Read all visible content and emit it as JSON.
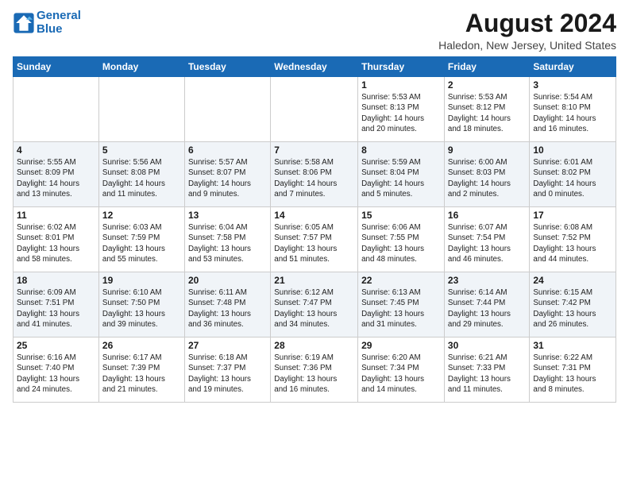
{
  "header": {
    "logo_line1": "General",
    "logo_line2": "Blue",
    "main_title": "August 2024",
    "subtitle": "Haledon, New Jersey, United States"
  },
  "calendar": {
    "days_of_week": [
      "Sunday",
      "Monday",
      "Tuesday",
      "Wednesday",
      "Thursday",
      "Friday",
      "Saturday"
    ],
    "weeks": [
      [
        {
          "day": "",
          "info": ""
        },
        {
          "day": "",
          "info": ""
        },
        {
          "day": "",
          "info": ""
        },
        {
          "day": "",
          "info": ""
        },
        {
          "day": "1",
          "info": "Sunrise: 5:53 AM\nSunset: 8:13 PM\nDaylight: 14 hours\nand 20 minutes."
        },
        {
          "day": "2",
          "info": "Sunrise: 5:53 AM\nSunset: 8:12 PM\nDaylight: 14 hours\nand 18 minutes."
        },
        {
          "day": "3",
          "info": "Sunrise: 5:54 AM\nSunset: 8:10 PM\nDaylight: 14 hours\nand 16 minutes."
        }
      ],
      [
        {
          "day": "4",
          "info": "Sunrise: 5:55 AM\nSunset: 8:09 PM\nDaylight: 14 hours\nand 13 minutes."
        },
        {
          "day": "5",
          "info": "Sunrise: 5:56 AM\nSunset: 8:08 PM\nDaylight: 14 hours\nand 11 minutes."
        },
        {
          "day": "6",
          "info": "Sunrise: 5:57 AM\nSunset: 8:07 PM\nDaylight: 14 hours\nand 9 minutes."
        },
        {
          "day": "7",
          "info": "Sunrise: 5:58 AM\nSunset: 8:06 PM\nDaylight: 14 hours\nand 7 minutes."
        },
        {
          "day": "8",
          "info": "Sunrise: 5:59 AM\nSunset: 8:04 PM\nDaylight: 14 hours\nand 5 minutes."
        },
        {
          "day": "9",
          "info": "Sunrise: 6:00 AM\nSunset: 8:03 PM\nDaylight: 14 hours\nand 2 minutes."
        },
        {
          "day": "10",
          "info": "Sunrise: 6:01 AM\nSunset: 8:02 PM\nDaylight: 14 hours\nand 0 minutes."
        }
      ],
      [
        {
          "day": "11",
          "info": "Sunrise: 6:02 AM\nSunset: 8:01 PM\nDaylight: 13 hours\nand 58 minutes."
        },
        {
          "day": "12",
          "info": "Sunrise: 6:03 AM\nSunset: 7:59 PM\nDaylight: 13 hours\nand 55 minutes."
        },
        {
          "day": "13",
          "info": "Sunrise: 6:04 AM\nSunset: 7:58 PM\nDaylight: 13 hours\nand 53 minutes."
        },
        {
          "day": "14",
          "info": "Sunrise: 6:05 AM\nSunset: 7:57 PM\nDaylight: 13 hours\nand 51 minutes."
        },
        {
          "day": "15",
          "info": "Sunrise: 6:06 AM\nSunset: 7:55 PM\nDaylight: 13 hours\nand 48 minutes."
        },
        {
          "day": "16",
          "info": "Sunrise: 6:07 AM\nSunset: 7:54 PM\nDaylight: 13 hours\nand 46 minutes."
        },
        {
          "day": "17",
          "info": "Sunrise: 6:08 AM\nSunset: 7:52 PM\nDaylight: 13 hours\nand 44 minutes."
        }
      ],
      [
        {
          "day": "18",
          "info": "Sunrise: 6:09 AM\nSunset: 7:51 PM\nDaylight: 13 hours\nand 41 minutes."
        },
        {
          "day": "19",
          "info": "Sunrise: 6:10 AM\nSunset: 7:50 PM\nDaylight: 13 hours\nand 39 minutes."
        },
        {
          "day": "20",
          "info": "Sunrise: 6:11 AM\nSunset: 7:48 PM\nDaylight: 13 hours\nand 36 minutes."
        },
        {
          "day": "21",
          "info": "Sunrise: 6:12 AM\nSunset: 7:47 PM\nDaylight: 13 hours\nand 34 minutes."
        },
        {
          "day": "22",
          "info": "Sunrise: 6:13 AM\nSunset: 7:45 PM\nDaylight: 13 hours\nand 31 minutes."
        },
        {
          "day": "23",
          "info": "Sunrise: 6:14 AM\nSunset: 7:44 PM\nDaylight: 13 hours\nand 29 minutes."
        },
        {
          "day": "24",
          "info": "Sunrise: 6:15 AM\nSunset: 7:42 PM\nDaylight: 13 hours\nand 26 minutes."
        }
      ],
      [
        {
          "day": "25",
          "info": "Sunrise: 6:16 AM\nSunset: 7:40 PM\nDaylight: 13 hours\nand 24 minutes."
        },
        {
          "day": "26",
          "info": "Sunrise: 6:17 AM\nSunset: 7:39 PM\nDaylight: 13 hours\nand 21 minutes."
        },
        {
          "day": "27",
          "info": "Sunrise: 6:18 AM\nSunset: 7:37 PM\nDaylight: 13 hours\nand 19 minutes."
        },
        {
          "day": "28",
          "info": "Sunrise: 6:19 AM\nSunset: 7:36 PM\nDaylight: 13 hours\nand 16 minutes."
        },
        {
          "day": "29",
          "info": "Sunrise: 6:20 AM\nSunset: 7:34 PM\nDaylight: 13 hours\nand 14 minutes."
        },
        {
          "day": "30",
          "info": "Sunrise: 6:21 AM\nSunset: 7:33 PM\nDaylight: 13 hours\nand 11 minutes."
        },
        {
          "day": "31",
          "info": "Sunrise: 6:22 AM\nSunset: 7:31 PM\nDaylight: 13 hours\nand 8 minutes."
        }
      ]
    ]
  }
}
